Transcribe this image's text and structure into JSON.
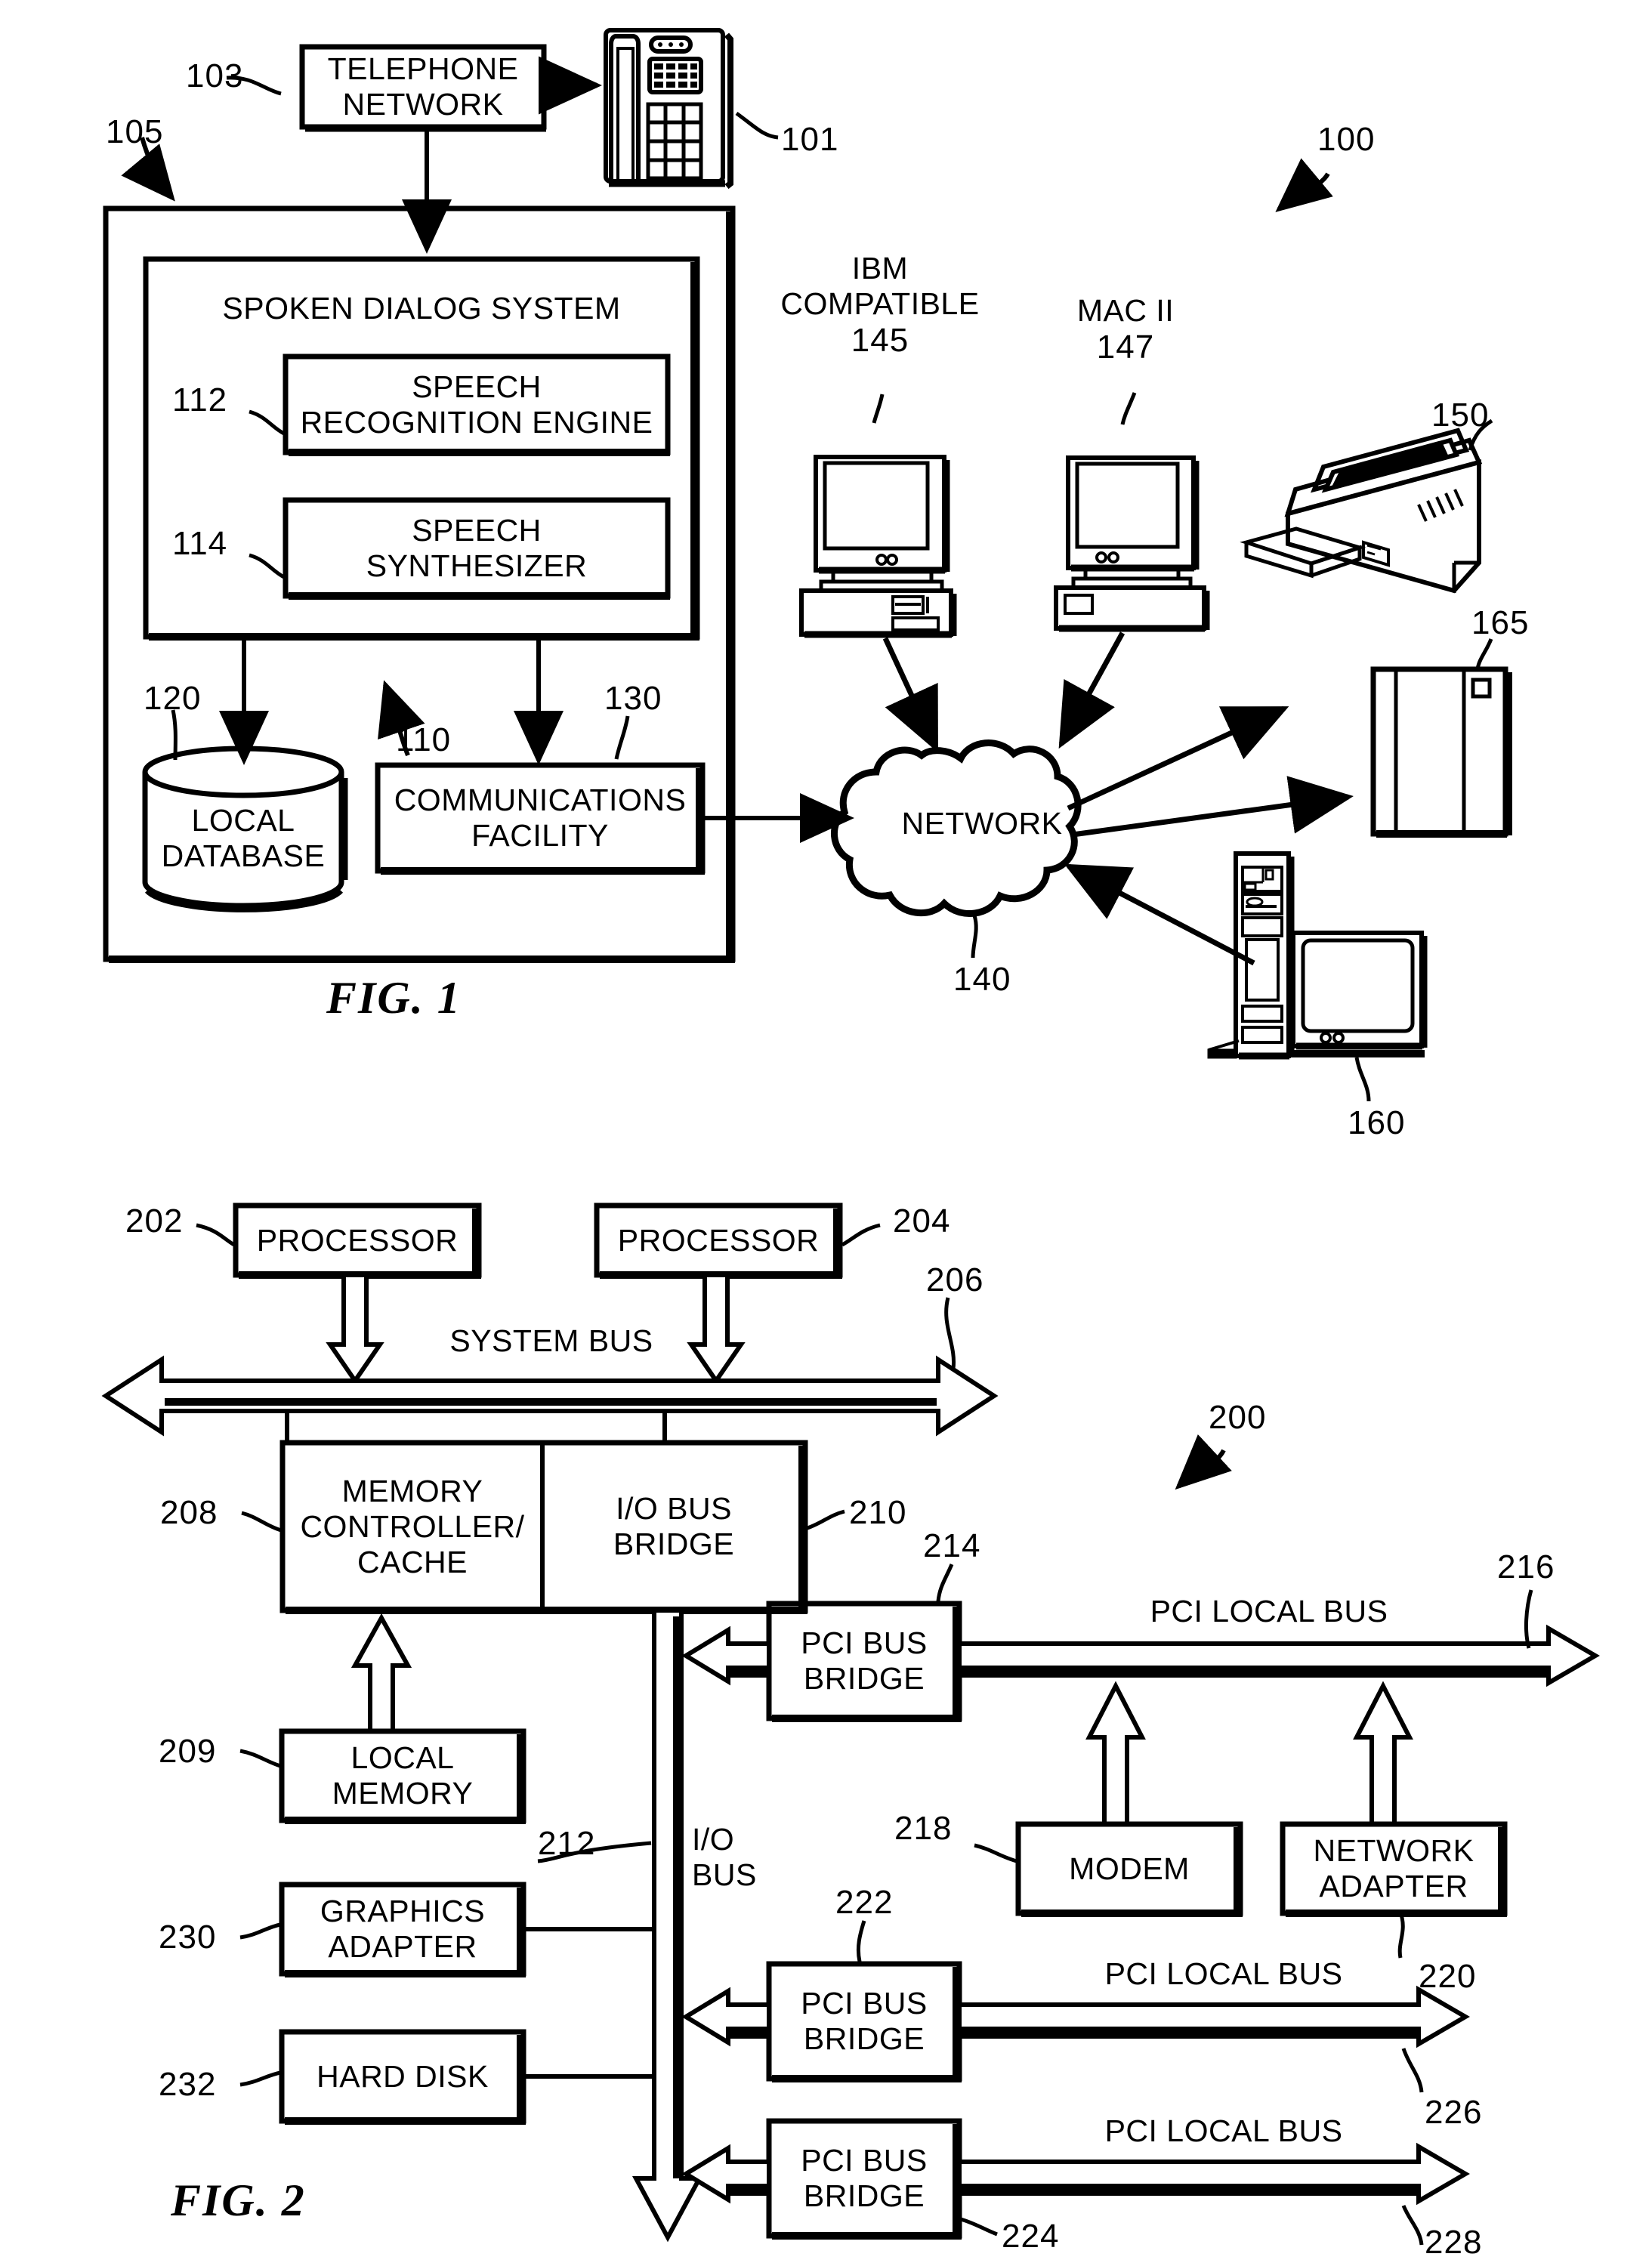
{
  "figures": [
    {
      "id": "fig1",
      "caption": "FIG. 1",
      "system_ref": "100",
      "blocks": {
        "telephone_network": "TELEPHONE NETWORK",
        "telephone_network_l1": "TELEPHONE",
        "telephone_network_l2": "NETWORK",
        "spoken_dialog_system": "SPOKEN DIALOG SYSTEM",
        "speech_recognition_engine_l1": "SPEECH",
        "speech_recognition_engine_l2": "RECOGNITION ENGINE",
        "speech_synthesizer_l1": "SPEECH",
        "speech_synthesizer_l2": "SYNTHESIZER",
        "local_database_l1": "LOCAL",
        "local_database_l2": "DATABASE",
        "communications_facility_l1": "COMMUNICATIONS",
        "communications_facility_l2": "FACILITY",
        "network_cloud": "NETWORK",
        "ibm_compatible_l1": "IBM",
        "ibm_compatible_l2": "COMPATIBLE",
        "ibm_compatible_ref": "145",
        "mac_ii_l1": "MAC II",
        "mac_ii_ref": "147"
      },
      "refs": {
        "telephone_set": "101",
        "telephone_network": "103",
        "system_boundary": "105",
        "spoken_dialog_system": "110",
        "speech_recognition_engine": "112",
        "speech_synthesizer": "114",
        "local_database": "120",
        "communications_facility": "130",
        "network": "140",
        "printer": "150",
        "server_tower": "160",
        "storage_cabinet": "165"
      }
    },
    {
      "id": "fig2",
      "caption": "FIG. 2",
      "system_ref": "200",
      "blocks": {
        "processor_a": "PROCESSOR",
        "processor_b": "PROCESSOR",
        "system_bus": "SYSTEM BUS",
        "memory_controller_l1": "MEMORY",
        "memory_controller_l2": "CONTROLLER/",
        "memory_controller_l3": "CACHE",
        "io_bus_bridge_l1": "I/O BUS",
        "io_bus_bridge_l2": "BRIDGE",
        "local_memory_l1": "LOCAL",
        "local_memory_l2": "MEMORY",
        "io_bus_l1": "I/O",
        "io_bus_l2": "BUS",
        "graphics_adapter_l1": "GRAPHICS",
        "graphics_adapter_l2": "ADAPTER",
        "hard_disk": "HARD DISK",
        "pci_bus_bridge_1_l1": "PCI BUS",
        "pci_bus_bridge_1_l2": "BRIDGE",
        "pci_bus_bridge_2_l1": "PCI BUS",
        "pci_bus_bridge_2_l2": "BRIDGE",
        "pci_bus_bridge_3_l1": "PCI BUS",
        "pci_bus_bridge_3_l2": "BRIDGE",
        "pci_local_bus_1": "PCI LOCAL BUS",
        "pci_local_bus_2": "PCI LOCAL BUS",
        "pci_local_bus_3": "PCI LOCAL BUS",
        "modem": "MODEM",
        "network_adapter_l1": "NETWORK",
        "network_adapter_l2": "ADAPTER"
      },
      "refs": {
        "processor_a": "202",
        "processor_b": "204",
        "system_bus": "206",
        "memory_controller": "208",
        "local_memory": "209",
        "io_bus_bridge": "210",
        "io_bus": "212",
        "pci_bus_bridge_1": "214",
        "pci_local_bus_1": "216",
        "modem": "218",
        "network_adapter": "220",
        "pci_bus_bridge_2": "222",
        "pci_bus_bridge_3": "224",
        "pci_local_bus_2": "226",
        "pci_local_bus_3": "228",
        "graphics_adapter": "230",
        "hard_disk": "232"
      }
    }
  ],
  "colors": {
    "ink": "#000000",
    "paper": "#ffffff"
  }
}
